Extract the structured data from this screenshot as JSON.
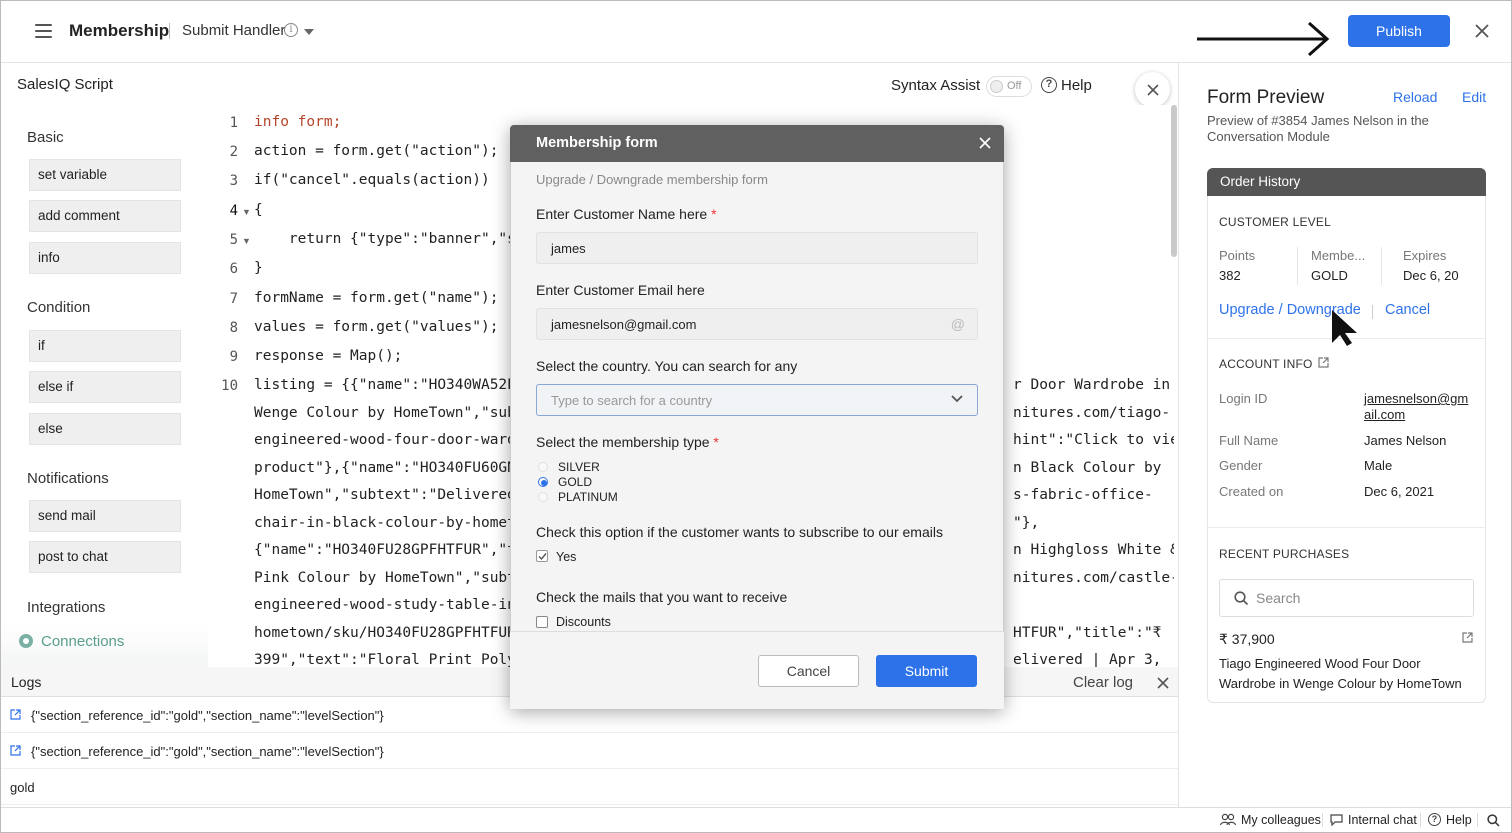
{
  "header": {
    "app_title": "Membership",
    "handler": "Submit Handler",
    "publish_label": "Publish"
  },
  "editor": {
    "title": "SalesIQ Script",
    "syntax_assist": "Syntax Assist",
    "toggle_state": "Off",
    "help": "Help",
    "lines": [
      {
        "n": "1",
        "text": "info form;"
      },
      {
        "n": "2",
        "text": "action = form.get(\"action\");"
      },
      {
        "n": "3",
        "text": "if(\"cancel\".equals(action))"
      },
      {
        "n": "4",
        "text": "{"
      },
      {
        "n": "5",
        "text": "    return {\"type\":\"banner\",\"st"
      },
      {
        "n": "6",
        "text": "}"
      },
      {
        "n": "7",
        "text": "formName = form.get(\"name\");"
      },
      {
        "n": "8",
        "text": "values = form.get(\"values\");"
      },
      {
        "n": "9",
        "text": "response = Map();"
      },
      {
        "n": "10",
        "text": "listing = {{\"name\":\"HO340WA52EI"
      }
    ],
    "wrapped_left": [
      "Wenge Colour by HomeTown\",\"subte",
      "engineered-wood-four-door-wardro",
      "product\"},{\"name\":\"HO340FU60GNZ",
      "HomeTown\",\"subtext\":\"Delivered ",
      "chair-in-black-colour-by-hometow",
      "{\"name\":\"HO340FU28GPFHTFUR\",\"ti",
      "Pink Colour by HomeTown\",\"subte",
      "engineered-wood-study-table-in-",
      "hometown/sku/HO340FU28GPFHTFUR\"",
      "399\",\"text\":\"Floral Print Polye"
    ],
    "wrapped_right": [
      "r Door Wardrobe in",
      "nitures.com/tiago-",
      "hint\":\"Click to view",
      "n Black Colour by",
      "s-fabric-office-",
      "\"},",
      "n Highgloss White &",
      "nitures.com/castle-",
      "",
      "HTFUR\",\"title\":\"₹",
      "elivered | Apr 3,"
    ]
  },
  "sidebar": {
    "sections": [
      {
        "title": "Basic",
        "items": [
          "set variable",
          "add comment",
          "info"
        ]
      },
      {
        "title": "Condition",
        "items": [
          "if",
          "else if",
          "else"
        ]
      },
      {
        "title": "Notifications",
        "items": [
          "send mail",
          "post to chat"
        ]
      },
      {
        "title": "Integrations",
        "items": []
      }
    ],
    "connections": "Connections"
  },
  "logs": {
    "title": "Logs",
    "clear": "Clear log",
    "entries": [
      "{\"section_reference_id\":\"gold\",\"section_name\":\"levelSection\"}",
      "{\"section_reference_id\":\"gold\",\"section_name\":\"levelSection\"}",
      "gold"
    ]
  },
  "modal": {
    "title": "Membership form",
    "subtitle": "Upgrade / Downgrade membership form",
    "name_label": "Enter Customer Name here",
    "name_value": "james",
    "email_label": "Enter Customer Email here",
    "email_value": "jamesnelson@gmail.com",
    "country_label": "Select the country. You can search for any",
    "country_placeholder": "Type to search for a country",
    "membership_label": "Select the membership type",
    "membership_options": [
      "SILVER",
      "GOLD",
      "PLATINUM"
    ],
    "membership_selected": "GOLD",
    "subscribe_label": "Check this option if the customer wants to subscribe to our emails",
    "subscribe_option": "Yes",
    "mails_label": "Check the mails that you want to receive",
    "mails_option": "Discounts",
    "cancel": "Cancel",
    "submit": "Submit"
  },
  "preview": {
    "title": "Form Preview",
    "reload": "Reload",
    "edit": "Edit",
    "subtitle": "Preview of #3854 James Nelson in the Conversation Module",
    "card_title": "Order History",
    "customer_level": "CUSTOMER LEVEL",
    "points_label": "Points",
    "points_value": "382",
    "member_label": "Membe...",
    "member_value": "GOLD",
    "expires_label": "Expires",
    "expires_value": "Dec 6, 20",
    "upgrade": "Upgrade / Downgrade",
    "cancel": "Cancel",
    "account_info": "ACCOUNT INFO",
    "login_label": "Login ID",
    "login_value_1": "jamesnelson@gm",
    "login_value_2": "ail.com",
    "fullname_label": "Full Name",
    "fullname_value": "James Nelson",
    "gender_label": "Gender",
    "gender_value": "Male",
    "created_label": "Created on",
    "created_value": "Dec 6, 2021",
    "recent": "RECENT PURCHASES",
    "search_placeholder": "Search",
    "price": "₹ 37,900",
    "product": "Tiago Engineered Wood Four Door Wardrobe in Wenge Colour by HomeTown"
  },
  "bottombar": {
    "colleagues": "My colleagues",
    "chat": "Internal chat",
    "help": "Help"
  },
  "colors": {
    "accent": "#2e72ea",
    "modal_header": "#606060",
    "connections": "#5a9e8e"
  }
}
